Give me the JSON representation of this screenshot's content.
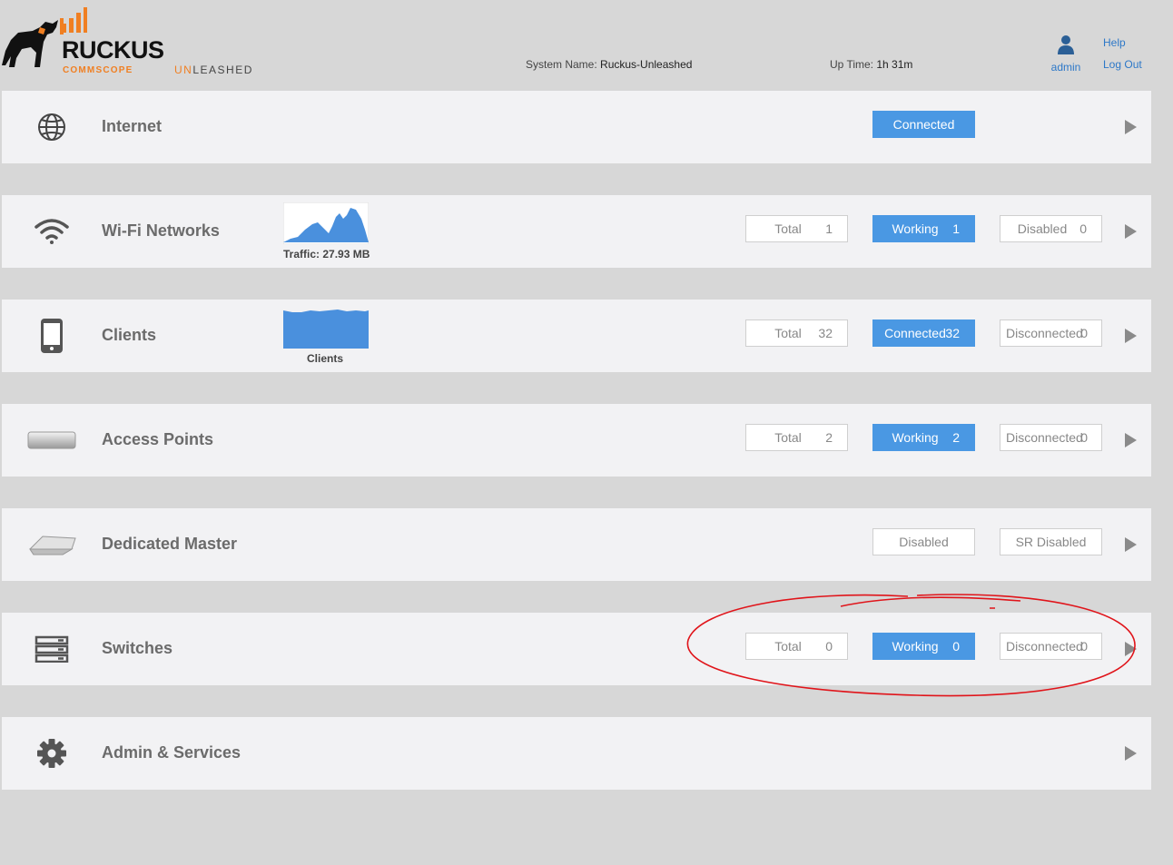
{
  "header": {
    "brand": "RUCKUS",
    "brand_sub": "COMMSCOPE",
    "product_prefix": "UN",
    "product_suffix": "LEASHED",
    "system_name_label": "System Name:",
    "system_name": "Ruckus-Unleashed",
    "uptime_label": "Up Time:",
    "uptime": "1h 31m",
    "user": "admin",
    "help": "Help",
    "logout": "Log Out"
  },
  "rows": {
    "internet": {
      "title": "Internet",
      "status": "Connected"
    },
    "wifi": {
      "title": "Wi-Fi Networks",
      "chart_caption": "Traffic: 27.93 MB",
      "total_label": "Total",
      "total": "1",
      "working_label": "Working",
      "working": "1",
      "disabled_label": "Disabled",
      "disabled": "0"
    },
    "clients": {
      "title": "Clients",
      "chart_caption": "Clients",
      "total_label": "Total",
      "total": "32",
      "connected_label": "Connected",
      "connected": "32",
      "disconnected_label": "Disconnected",
      "disconnected": "0"
    },
    "access_points": {
      "title": "Access Points",
      "total_label": "Total",
      "total": "2",
      "working_label": "Working",
      "working": "2",
      "disconnected_label": "Disconnected",
      "disconnected": "0"
    },
    "dedicated_master": {
      "title": "Dedicated Master",
      "status": "Disabled",
      "sr_status": "SR Disabled"
    },
    "switches": {
      "title": "Switches",
      "total_label": "Total",
      "total": "0",
      "working_label": "Working",
      "working": "0",
      "disconnected_label": "Disconnected",
      "disconnected": "0"
    },
    "admin": {
      "title": "Admin & Services"
    }
  },
  "colors": {
    "accent_blue": "#4a98e3",
    "brand_orange": "#f07f22",
    "annotation_red": "#e0141a"
  },
  "icons": [
    "globe-icon",
    "wifi-icon",
    "phone-icon",
    "access-point-icon",
    "master-ap-icon",
    "switch-icon",
    "gear-icon",
    "user-icon",
    "dog-logo-icon"
  ]
}
